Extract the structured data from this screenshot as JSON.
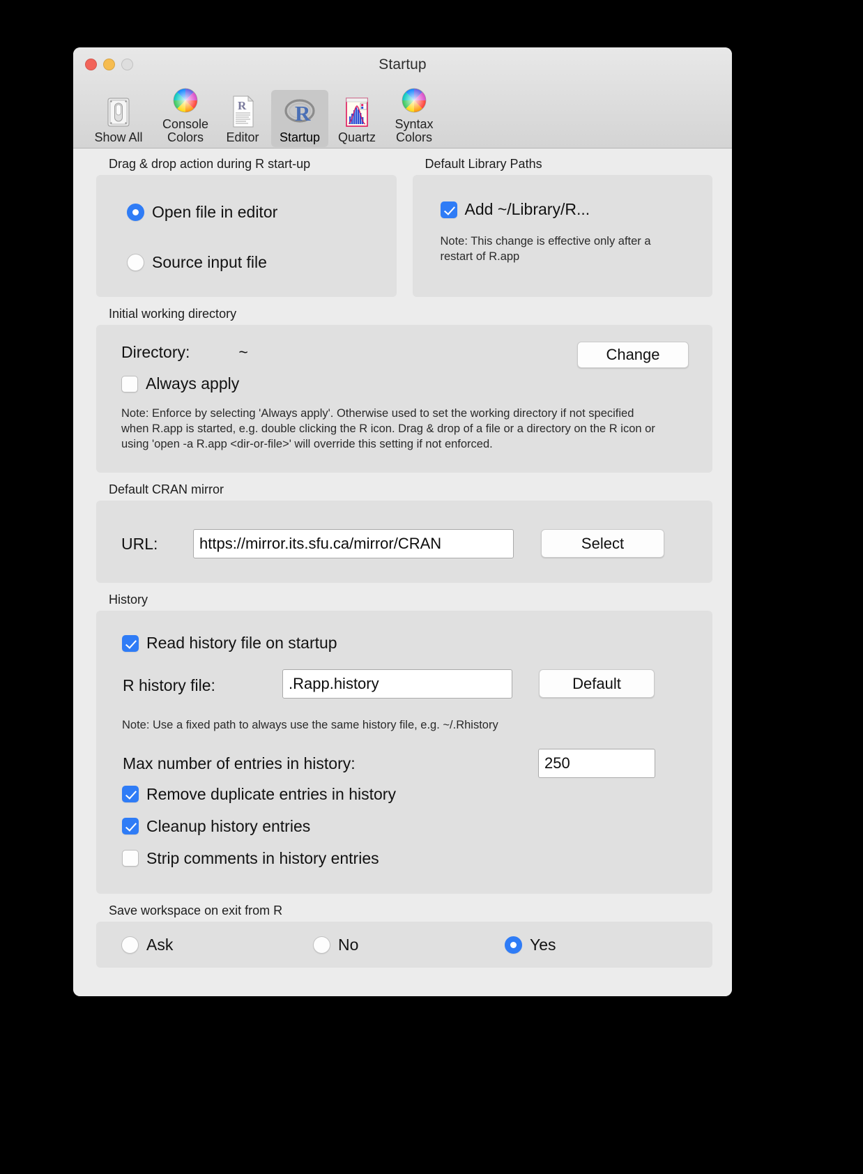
{
  "window": {
    "title": "Startup",
    "traffic_lights": [
      "close-button",
      "minimize-button",
      "zoom-button"
    ]
  },
  "toolbar": {
    "items": [
      {
        "label": "Show All",
        "icon": "show-all-icon",
        "selected": false
      },
      {
        "label": "Console\nColors",
        "icon": "color-wheel-icon",
        "selected": false
      },
      {
        "label": "Editor",
        "icon": "editor-document-icon",
        "selected": false
      },
      {
        "label": "Startup",
        "icon": "r-logo-icon",
        "selected": true
      },
      {
        "label": "Quartz",
        "icon": "quartz-chart-icon",
        "selected": false
      },
      {
        "label": "Syntax\nColors",
        "icon": "color-wheel-icon",
        "selected": false
      }
    ]
  },
  "drag_drop": {
    "group_title": "Drag & drop action during R start-up",
    "options": [
      {
        "label": "Open file in editor",
        "selected": true
      },
      {
        "label": "Source input file",
        "selected": false
      }
    ]
  },
  "library_paths": {
    "group_title": "Default Library Paths",
    "checkbox_label": "Add ~/Library/R...",
    "checkbox_checked": true,
    "note": "Note: This change is effective only after a restart of R.app"
  },
  "working_directory": {
    "group_title": "Initial working directory",
    "directory_label": "Directory:",
    "directory_value": "~",
    "change_button": "Change",
    "always_apply_label": "Always apply",
    "always_apply_checked": false,
    "note": "Note: Enforce by selecting 'Always apply'. Otherwise used to set the working directory if not specified when R.app is started, e.g. double clicking the R icon. Drag & drop of a file or a directory on the R icon or using 'open -a R.app <dir-or-file>' will override this setting if not enforced."
  },
  "cran_mirror": {
    "group_title": "Default CRAN mirror",
    "url_label": "URL:",
    "url_value": "https://mirror.its.sfu.ca/mirror/CRAN",
    "select_button": "Select"
  },
  "history": {
    "group_title": "History",
    "read_on_startup_label": "Read history file on startup",
    "read_on_startup_checked": true,
    "history_file_label": "R history file:",
    "history_file_value": ".Rapp.history",
    "default_button": "Default",
    "note": "Note: Use a fixed path to always use the same history file, e.g. ~/.Rhistory",
    "max_entries_label": "Max number of entries in history:",
    "max_entries_value": "250",
    "checkboxes": [
      {
        "label": "Remove duplicate entries in history",
        "checked": true
      },
      {
        "label": "Cleanup history entries",
        "checked": true
      },
      {
        "label": "Strip comments in history entries",
        "checked": false
      }
    ]
  },
  "save_workspace": {
    "group_title": "Save workspace on exit from R",
    "options": [
      {
        "label": "Ask",
        "selected": false
      },
      {
        "label": "No",
        "selected": false
      },
      {
        "label": "Yes",
        "selected": true
      }
    ]
  },
  "colors": {
    "accent": "#2f7cf6",
    "window_bg": "#ececec",
    "panel_bg": "#e0e0e0",
    "toolbar_selected_bg": "#c8c8c8"
  }
}
